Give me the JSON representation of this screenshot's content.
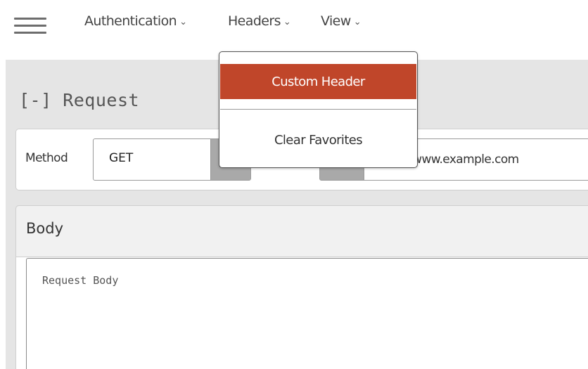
{
  "menubar": {
    "items": [
      {
        "label": "Authentication"
      },
      {
        "label": "Headers"
      },
      {
        "label": "View"
      }
    ]
  },
  "headers_menu": {
    "items": [
      {
        "label": "Custom Header",
        "highlighted": true
      },
      {
        "label": "Clear Favorites"
      }
    ]
  },
  "request": {
    "title": "[-] Request",
    "method_label": "Method",
    "method_value": "GET",
    "url_value": "https://www.example.com"
  },
  "body": {
    "title": "Body",
    "placeholder": "Request Body"
  },
  "icons": {
    "menu": "hamburger-icon",
    "dropdown_arrow": "chevron-down-icon"
  },
  "colors": {
    "highlight": "#c0462a",
    "workspace_bg": "#e5e5e5",
    "control_gray": "#a9a9a9"
  }
}
